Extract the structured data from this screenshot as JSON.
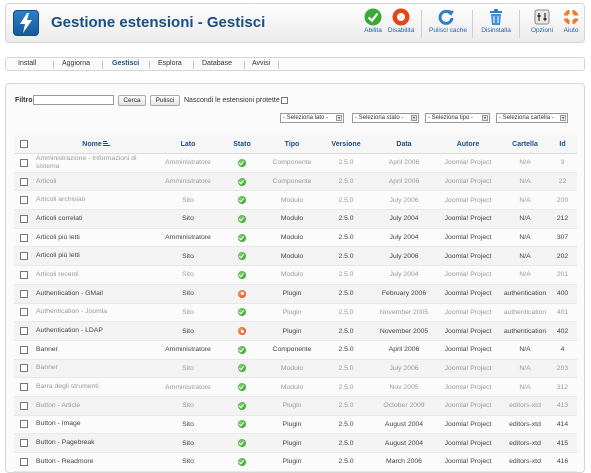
{
  "header": {
    "title": "Gestione estensioni - Gestisci",
    "toolbar": [
      {
        "label": "Abilita",
        "icon": "check-icon"
      },
      {
        "label": "Disabilita",
        "icon": "disable-icon"
      },
      {
        "label": "Pulisci cache",
        "icon": "refresh-icon"
      },
      {
        "label": "Disinstalla",
        "icon": "trash-icon"
      },
      {
        "label": "Opzioni",
        "icon": "options-icon"
      },
      {
        "label": "Aiuto",
        "icon": "help-icon"
      }
    ]
  },
  "tabs": [
    "Install",
    "Aggiorna",
    "Gestisci",
    "Esplora",
    "Database",
    "Avvisi"
  ],
  "active_tab": "Gestisci",
  "filter": {
    "label": "Filtro:",
    "value": "",
    "search_button": "Cerca",
    "clear_button": "Pulisci",
    "hide_protected_label": "Nascondi le estensioni protette"
  },
  "selects": [
    "- Seleziona lato -",
    "- Seleziona stato -",
    "- Seleziona tipo -",
    "- Seleziona cartella -"
  ],
  "table": {
    "columns": [
      "Nome",
      "Lato",
      "Stato",
      "Tipo",
      "Versione",
      "Data",
      "Autore",
      "Cartella",
      "Id"
    ],
    "rows": [
      {
        "name": "Amministrazione - Informazioni di sistema",
        "lato": "Amministratore",
        "stato": "on",
        "tipo": "Componente",
        "versione": "2.5.0",
        "data": "April 2006",
        "autore": "Joomla! Project",
        "cartella": "N/A",
        "id": "3",
        "disabled": true
      },
      {
        "name": "Articoli",
        "lato": "Amministratore",
        "stato": "on",
        "tipo": "Componente",
        "versione": "2.5.0",
        "data": "April 2006",
        "autore": "Joomla! Project",
        "cartella": "N/A",
        "id": "22",
        "disabled": true
      },
      {
        "name": "Articoli archiviati",
        "lato": "Sito",
        "stato": "on",
        "tipo": "Modulo",
        "versione": "2.5.0",
        "data": "July 2006",
        "autore": "Joomla! Project",
        "cartella": "N/A",
        "id": "200",
        "disabled": true
      },
      {
        "name": "Articoli correlati",
        "lato": "Sito",
        "stato": "on",
        "tipo": "Modulo",
        "versione": "2.5.0",
        "data": "July 2004",
        "autore": "Joomla! Project",
        "cartella": "N/A",
        "id": "212",
        "disabled": false
      },
      {
        "name": "Articoli più letti",
        "lato": "Amministratore",
        "stato": "on",
        "tipo": "Modulo",
        "versione": "2.5.0",
        "data": "July 2004",
        "autore": "Joomla! Project",
        "cartella": "N/A",
        "id": "307",
        "disabled": false
      },
      {
        "name": "Articoli più letti",
        "lato": "Sito",
        "stato": "on",
        "tipo": "Modulo",
        "versione": "2.5.0",
        "data": "July 2006",
        "autore": "Joomla! Project",
        "cartella": "N/A",
        "id": "202",
        "disabled": false
      },
      {
        "name": "Articoli recenti",
        "lato": "Sito",
        "stato": "on",
        "tipo": "Modulo",
        "versione": "2.5.0",
        "data": "July 2004",
        "autore": "Joomla! Project",
        "cartella": "N/A",
        "id": "201",
        "disabled": true
      },
      {
        "name": "Authentication - GMail",
        "lato": "Sito",
        "stato": "off",
        "tipo": "Plugin",
        "versione": "2.5.0",
        "data": "February 2006",
        "autore": "Joomla! Project",
        "cartella": "authentication",
        "id": "400",
        "disabled": false
      },
      {
        "name": "Authentication - Joomla",
        "lato": "Sito",
        "stato": "on",
        "tipo": "Plugin",
        "versione": "2.5.0",
        "data": "November 2005",
        "autore": "Joomla! Project",
        "cartella": "authentication",
        "id": "401",
        "disabled": true
      },
      {
        "name": "Authentication - LDAP",
        "lato": "Sito",
        "stato": "off",
        "tipo": "Plugin",
        "versione": "2.5.0",
        "data": "November 2005",
        "autore": "Joomla! Project",
        "cartella": "authentication",
        "id": "402",
        "disabled": false
      },
      {
        "name": "Banner",
        "lato": "Amministratore",
        "stato": "on",
        "tipo": "Componente",
        "versione": "2.5.0",
        "data": "April 2006",
        "autore": "Joomla! Project",
        "cartella": "N/A",
        "id": "4",
        "disabled": false
      },
      {
        "name": "Banner",
        "lato": "Sito",
        "stato": "on",
        "tipo": "Modulo",
        "versione": "2.5.0",
        "data": "July 2006",
        "autore": "Joomla! Project",
        "cartella": "N/A",
        "id": "203",
        "disabled": true
      },
      {
        "name": "Barra degli strumenti",
        "lato": "Amministratore",
        "stato": "on",
        "tipo": "Modulo",
        "versione": "2.5.0",
        "data": "Nov 2005",
        "autore": "Joomla! Project",
        "cartella": "N/A",
        "id": "312",
        "disabled": true
      },
      {
        "name": "Button - Article",
        "lato": "Sito",
        "stato": "on",
        "tipo": "Plugin",
        "versione": "2.5.0",
        "data": "October 2009",
        "autore": "Joomla! Project",
        "cartella": "editors-xtd",
        "id": "413",
        "disabled": true
      },
      {
        "name": "Button - Image",
        "lato": "Sito",
        "stato": "on",
        "tipo": "Plugin",
        "versione": "2.5.0",
        "data": "August 2004",
        "autore": "Joomla! Project",
        "cartella": "editors-xtd",
        "id": "414",
        "disabled": false
      },
      {
        "name": "Button - Pagebreak",
        "lato": "Sito",
        "stato": "on",
        "tipo": "Plugin",
        "versione": "2.5.0",
        "data": "August 2004",
        "autore": "Joomla! Project",
        "cartella": "editors-xtd",
        "id": "415",
        "disabled": false
      },
      {
        "name": "Button - Readmore",
        "lato": "Sito",
        "stato": "on",
        "tipo": "Plugin",
        "versione": "2.5.0",
        "data": "March 2006",
        "autore": "Joomla! Project",
        "cartella": "editors-xtd",
        "id": "416",
        "disabled": false
      }
    ]
  },
  "colors": {
    "title": "#1a4f86",
    "link": "#2262a6",
    "enabled": "#2a9a1f",
    "disabled_status": "#d8400f"
  }
}
